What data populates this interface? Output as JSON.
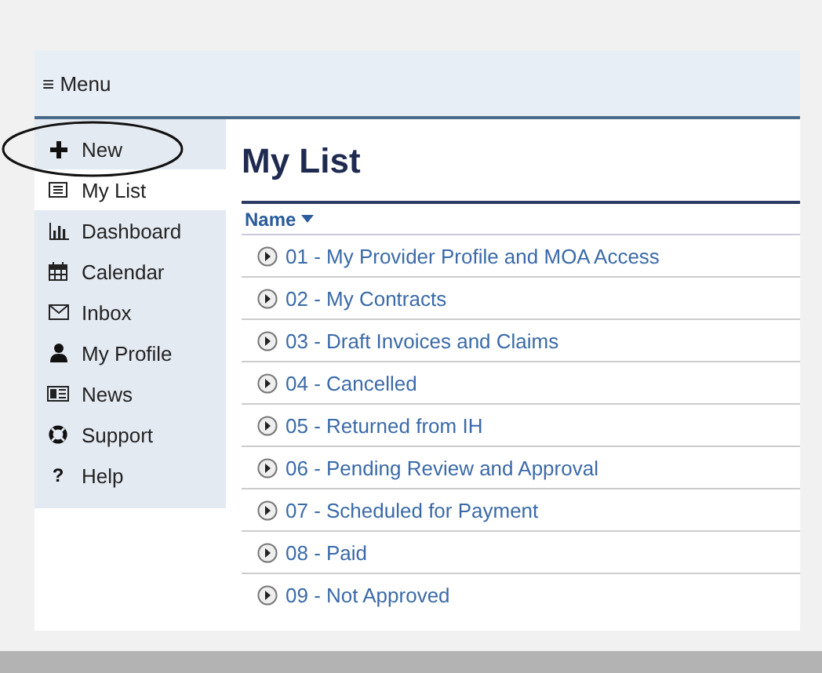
{
  "menu_bar": {
    "label": "≡ Menu"
  },
  "sidebar": {
    "items": [
      {
        "kind": "new",
        "label": "New",
        "selected": false,
        "circled": true
      },
      {
        "kind": "list",
        "label": "My List",
        "selected": true,
        "circled": false
      },
      {
        "kind": "dashboard",
        "label": "Dashboard",
        "selected": false,
        "circled": false
      },
      {
        "kind": "calendar",
        "label": "Calendar",
        "selected": false,
        "circled": false
      },
      {
        "kind": "inbox",
        "label": "Inbox",
        "selected": false,
        "circled": false
      },
      {
        "kind": "profile",
        "label": "My Profile",
        "selected": false,
        "circled": false
      },
      {
        "kind": "news",
        "label": "News",
        "selected": false,
        "circled": false
      },
      {
        "kind": "support",
        "label": "Support",
        "selected": false,
        "circled": false
      },
      {
        "kind": "help",
        "glyph": "?",
        "label": "Help",
        "selected": false,
        "circled": false
      }
    ]
  },
  "page_title": "My List",
  "table": {
    "columns": [
      {
        "label": "Name",
        "sorted": true
      }
    ],
    "rows": [
      "01 - My Provider Profile and MOA Access",
      "02 - My Contracts",
      "03 - Draft Invoices and Claims",
      "04 - Cancelled",
      "05 - Returned from IH",
      "06 - Pending Review and Approval",
      "07 - Scheduled for Payment",
      "08 - Paid",
      "09 - Not Approved"
    ]
  }
}
